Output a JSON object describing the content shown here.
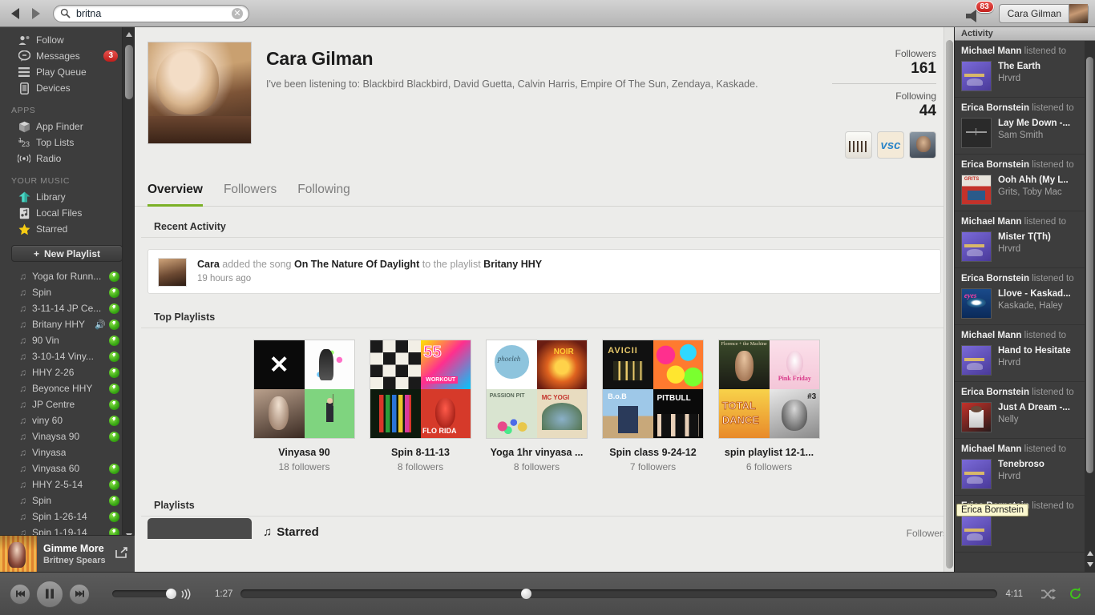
{
  "topbar": {
    "back_icon": "back-arrow-icon",
    "forward_icon": "forward-arrow-icon",
    "search_value": "britna",
    "search_placeholder": "Search",
    "notifications_count": "83",
    "user_name": "Cara Gilman"
  },
  "sidebar": {
    "nav_items": [
      {
        "label": "Follow",
        "icon": "follow-icon",
        "badge": ""
      },
      {
        "label": "Messages",
        "icon": "messages-icon",
        "badge": "3"
      },
      {
        "label": "Play Queue",
        "icon": "play-queue-icon",
        "badge": ""
      },
      {
        "label": "Devices",
        "icon": "devices-icon",
        "badge": ""
      }
    ],
    "apps_header": "APPS",
    "apps_items": [
      {
        "label": "App Finder",
        "icon": "app-finder-icon"
      },
      {
        "label": "Top Lists",
        "icon": "top-lists-icon"
      },
      {
        "label": "Radio",
        "icon": "radio-icon"
      }
    ],
    "music_header": "YOUR MUSIC",
    "music_items": [
      {
        "label": "Library",
        "icon": "library-icon"
      },
      {
        "label": "Local Files",
        "icon": "local-files-icon"
      },
      {
        "label": "Starred",
        "icon": "star-icon"
      }
    ],
    "new_playlist_label": "New Playlist",
    "playlists": [
      {
        "name": "Yoga for Runn...",
        "offline": true,
        "playing": false
      },
      {
        "name": "Spin",
        "offline": true,
        "playing": false
      },
      {
        "name": "3-11-14 JP Ce...",
        "offline": true,
        "playing": false
      },
      {
        "name": "Britany HHY",
        "offline": true,
        "playing": true
      },
      {
        "name": "90 Vin",
        "offline": true,
        "playing": false
      },
      {
        "name": "3-10-14 Viny...",
        "offline": true,
        "playing": false
      },
      {
        "name": "HHY 2-26",
        "offline": true,
        "playing": false
      },
      {
        "name": "Beyonce HHY",
        "offline": true,
        "playing": false
      },
      {
        "name": "JP Centre",
        "offline": true,
        "playing": false
      },
      {
        "name": "viny 60",
        "offline": true,
        "playing": false
      },
      {
        "name": "Vinaysa 90",
        "offline": true,
        "playing": false
      },
      {
        "name": "Vinyasa",
        "offline": false,
        "playing": false
      },
      {
        "name": "Vinyasa 60",
        "offline": true,
        "playing": false
      },
      {
        "name": "HHY 2-5-14",
        "offline": true,
        "playing": false
      },
      {
        "name": "Spin",
        "offline": true,
        "playing": false
      },
      {
        "name": "Spin 1-26-14",
        "offline": true,
        "playing": false
      },
      {
        "name": "Spin 1-19-14",
        "offline": true,
        "playing": false
      }
    ]
  },
  "now_playing": {
    "title": "Gimme More",
    "artist": "Britney Spears",
    "elapsed": "1:27",
    "duration": "4:11",
    "shuffle_icon": "shuffle-icon",
    "repeat_icon": "repeat-icon",
    "repeat_active_color": "#3fc51a"
  },
  "profile": {
    "name": "Cara Gilman",
    "bio": "I've been listening to: Blackbird Blackbird, David Guetta, Calvin Harris, Empire Of The Sun, Zendaya, Kaskade.",
    "followers_label": "Followers",
    "followers_count": "161",
    "following_label": "Following",
    "following_count": "44",
    "follower_avatars": [
      "group-photo-avatar",
      "vsc-logo-avatar",
      "man-portrait-avatar"
    ]
  },
  "tabs": [
    {
      "label": "Overview",
      "active": true
    },
    {
      "label": "Followers",
      "active": false
    },
    {
      "label": "Following",
      "active": false
    }
  ],
  "recent_activity": {
    "heading": "Recent Activity",
    "entry": {
      "actor": "Cara",
      "verb": "added the song",
      "song": "On The Nature Of Daylight",
      "connector": "to the playlist",
      "playlist": "Britany HHY",
      "time": "19 hours ago"
    }
  },
  "top_playlists": {
    "heading": "Top Playlists",
    "cards": [
      {
        "title": "Vinyasa 90",
        "followers": "18 followers"
      },
      {
        "title": "Spin 8-11-13",
        "followers": "8 followers"
      },
      {
        "title": "Yoga 1hr vinyasa ...",
        "followers": "8 followers"
      },
      {
        "title": "Spin class 9-24-12",
        "followers": "7 followers"
      },
      {
        "title": "spin playlist 12-1...",
        "followers": "6 followers"
      }
    ]
  },
  "playlists_section": {
    "heading": "Playlists",
    "first_row_name": "Starred",
    "followers_col": "Followers"
  },
  "activity_panel": {
    "heading": "Activity",
    "tooltip": "Erica Bornstein",
    "listened_to": "listened to",
    "items": [
      {
        "user": "Michael Mann",
        "title": "The Earth",
        "artist": "Hrvrd",
        "art": "hrvrd-purple"
      },
      {
        "user": "Erica Bornstein",
        "title": "Lay Me Down -...",
        "artist": "Sam Smith",
        "art": "sam-smith-dark"
      },
      {
        "user": "Erica Bornstein",
        "title": "Ooh Ahh (My L..",
        "artist": "Grits, Toby Mac",
        "art": "grits-red"
      },
      {
        "user": "Michael Mann",
        "title": "Mister T(Th)",
        "artist": "Hrvrd",
        "art": "hrvrd-purple"
      },
      {
        "user": "Erica Bornstein",
        "title": "Llove - Kaskad...",
        "artist": "Kaskade, Haley",
        "art": "kaskade-eye"
      },
      {
        "user": "Michael Mann",
        "title": "Hand to Hesitate",
        "artist": "Hrvrd",
        "art": "hrvrd-purple"
      },
      {
        "user": "Erica Bornstein",
        "title": "Just A Dream -...",
        "artist": "Nelly",
        "art": "nelly-red"
      },
      {
        "user": "Michael Mann",
        "title": "Tenebroso",
        "artist": "Hrvrd",
        "art": "hrvrd-purple"
      },
      {
        "user": "Erica Bornstein",
        "title": "",
        "artist": "",
        "art": "hrvrd-purple"
      }
    ]
  }
}
